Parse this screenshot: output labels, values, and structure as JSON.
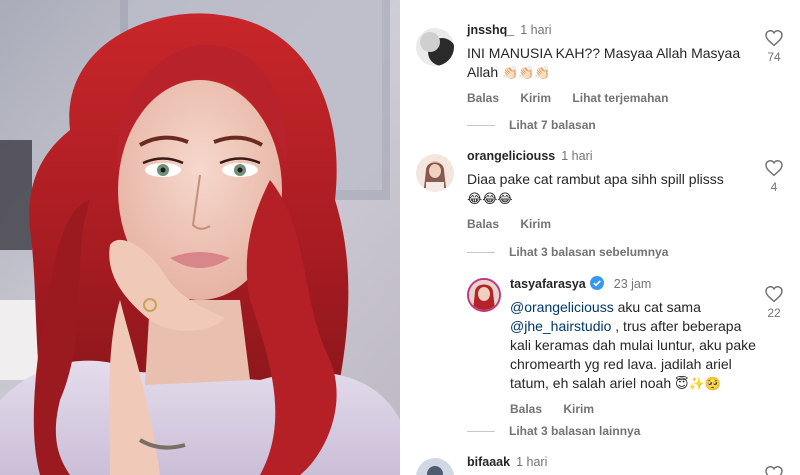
{
  "comments": [
    {
      "username": "jnsshq_",
      "time": "1 hari",
      "text": "INI MANUSIA KAH?? Masyaa Allah  Masyaa Allah",
      "emoji": "👏🏻👏🏻👏🏻",
      "actions": [
        "Balas",
        "Kirim",
        "Lihat terjemahan"
      ],
      "likes": "74",
      "view_replies": "Lihat 7 balasan"
    },
    {
      "username": "orangeliciouss",
      "time": "1 hari",
      "text": "Diaa pake cat rambut apa sihh spill plisss",
      "emoji": "😂😂😂",
      "actions": [
        "Balas",
        "Kirim"
      ],
      "likes": "4",
      "view_replies": "Lihat 3 balasan sebelumnya"
    },
    {
      "username": "tasyafarasya",
      "verified": true,
      "time": "23 jam",
      "mention1": "@orangeliciouss",
      "text1": " aku cat sama ",
      "mention2": "@jhe_hairstudio",
      "text2": " , trus after beberapa kali keramas dah mulai luntur, aku pake chromearth yg red lava. jadilah ariel tatum, eh salah ariel noah",
      "emoji": "😇✨🥺",
      "actions": [
        "Balas",
        "Kirim"
      ],
      "likes": "22",
      "view_replies": "Lihat 3 balasan lainnya"
    },
    {
      "username": "bifaaak",
      "time": "1 hari"
    }
  ],
  "icons": {
    "like": "heart-outline-icon",
    "verified": "verified-badge-icon"
  },
  "colors": {
    "verified": "#3897f0",
    "secondary_text": "#737373",
    "mention": "#00376b"
  }
}
